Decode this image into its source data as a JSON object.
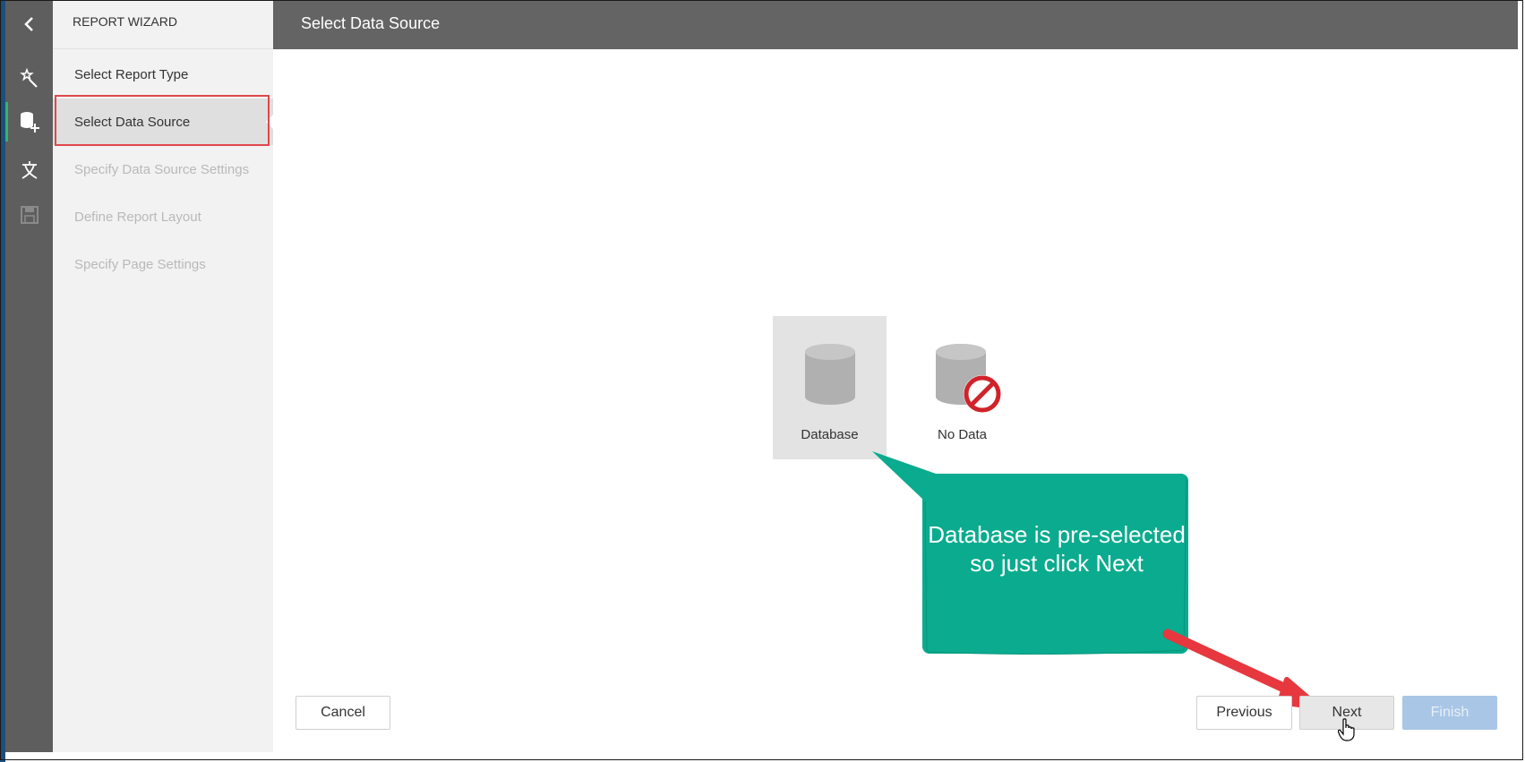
{
  "sidebar": {
    "title": "REPORT WIZARD",
    "steps": [
      {
        "label": "Select Report Type",
        "state": "done"
      },
      {
        "label": "Select Data Source",
        "state": "current"
      },
      {
        "label": "Specify Data Source Settings",
        "state": "disabled"
      },
      {
        "label": "Define Report Layout",
        "state": "disabled"
      },
      {
        "label": "Specify Page Settings",
        "state": "disabled"
      }
    ]
  },
  "icon_bar": {
    "items": [
      "back-icon",
      "wizard-icon",
      "add-data-source-icon",
      "localization-icon",
      "save-icon"
    ]
  },
  "header": {
    "title": "Select Data Source"
  },
  "options": [
    {
      "label": "Database",
      "icon": "database-icon",
      "selected": true
    },
    {
      "label": "No Data",
      "icon": "no-data-icon",
      "selected": false
    }
  ],
  "callout": {
    "text": "Database is pre-selected so just click Next"
  },
  "buttons": {
    "cancel": "Cancel",
    "previous": "Previous",
    "next": "Next",
    "finish": "Finish"
  },
  "colors": {
    "callout": "#0aab8e",
    "highlight": "#e0474c",
    "header": "#646464",
    "finish_disabled": "#a9c6e6"
  }
}
